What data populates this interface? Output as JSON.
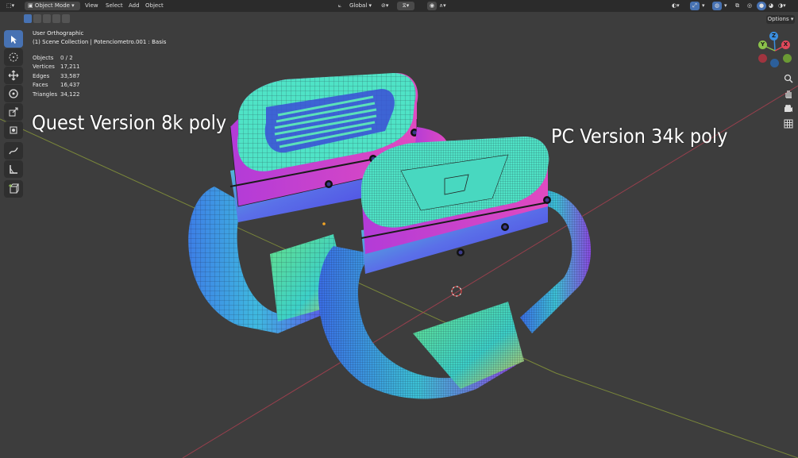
{
  "header": {
    "mode_label": "Object Mode",
    "menu": [
      "View",
      "Select",
      "Add",
      "Object"
    ],
    "transform_orientation": "Global",
    "options_label": "Options"
  },
  "viewport": {
    "view_name": "User Orthographic",
    "collection_path": "(1) Scene Collection | Potenciometro.001 : Basis",
    "stats": [
      {
        "label": "Objects",
        "value": "0 / 2"
      },
      {
        "label": "Vertices",
        "value": "17,211"
      },
      {
        "label": "Edges",
        "value": "33,587"
      },
      {
        "label": "Faces",
        "value": "16,437"
      },
      {
        "label": "Triangles",
        "value": "34,122"
      }
    ],
    "annotations": {
      "left": "Quest Version 8k poly",
      "right": "PC Version 34k poly"
    }
  },
  "gizmo": {
    "x": "X",
    "y": "Y",
    "z": "Z",
    "colors": {
      "x": "#e0485a",
      "y": "#8bc34a",
      "z": "#3b8fe0"
    }
  },
  "colors": {
    "accent": "#4772b3",
    "mesh_cyan": "#46e6c6",
    "mesh_magenta": "#d43fd6",
    "mesh_blue": "#4a4ae6"
  },
  "icons": {
    "toolbar": [
      "select-box-icon",
      "cursor-icon",
      "move-icon",
      "rotate-icon",
      "scale-icon",
      "transform-icon",
      "annotate-icon",
      "measure-icon",
      "add-cube-icon"
    ],
    "right": [
      "zoom-icon",
      "hand-icon",
      "camera-icon",
      "grid-icon"
    ]
  }
}
